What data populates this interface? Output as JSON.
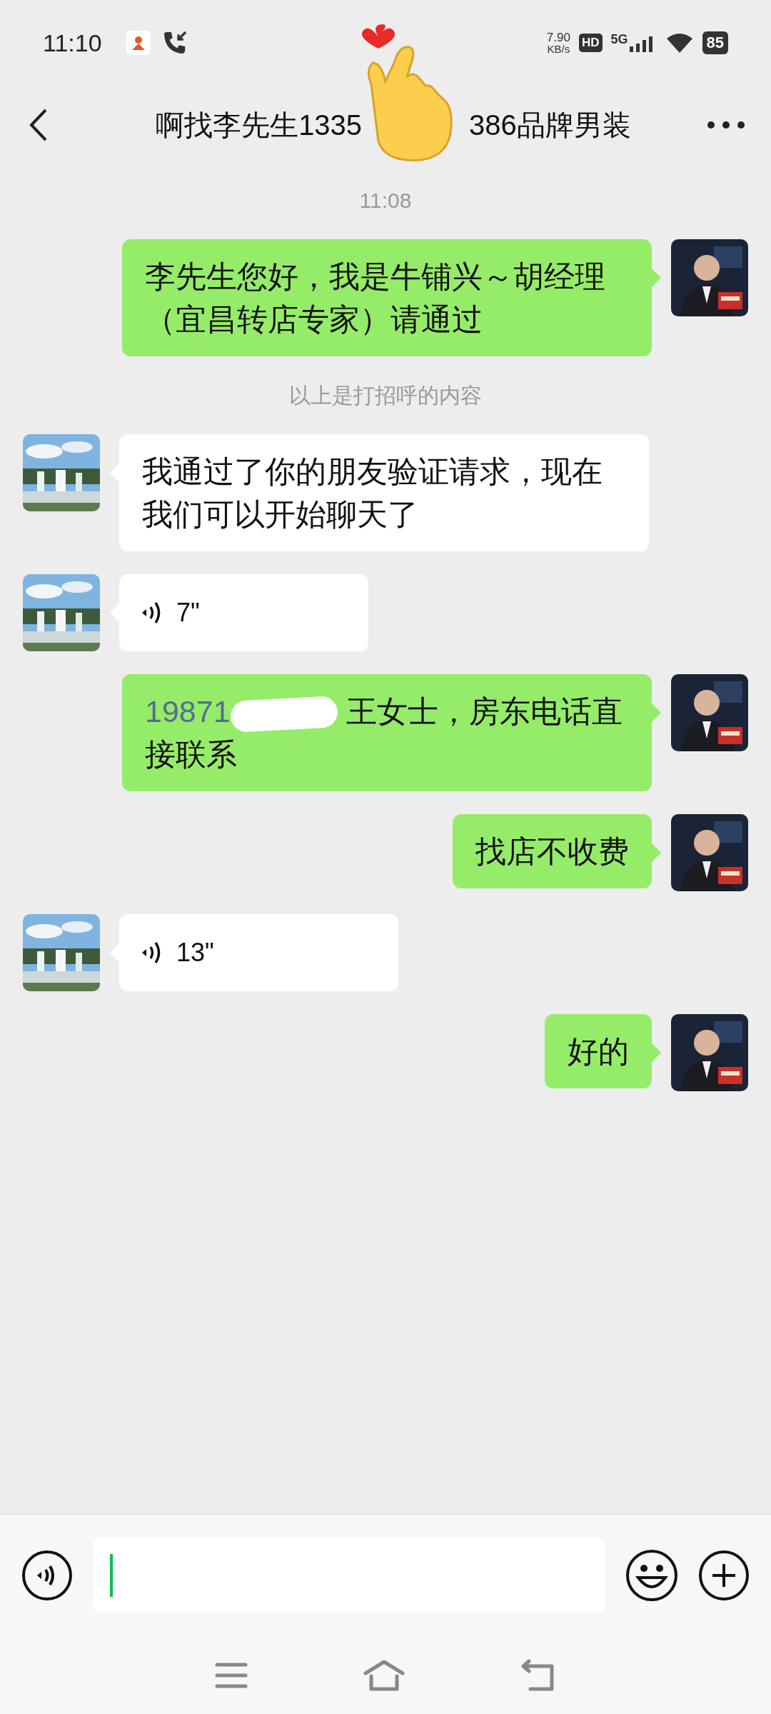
{
  "status_bar": {
    "time": "11:10",
    "speed": "7.90",
    "speed_unit": "KB/s",
    "hd": "HD",
    "network": "5G",
    "battery": "85"
  },
  "header": {
    "title_left": "啊找李先生1335",
    "title_right": "386品牌男装"
  },
  "messages": [
    {
      "kind": "timestamp",
      "text": "11:08"
    },
    {
      "kind": "text",
      "outgoing": true,
      "text": "李先生您好，我是牛铺兴～胡经理（宜昌转店专家）请通过"
    },
    {
      "kind": "system",
      "text": "以上是打招呼的内容"
    },
    {
      "kind": "text",
      "outgoing": false,
      "text": "我通过了你的朋友验证请求，现在我们可以开始聊天了"
    },
    {
      "kind": "voice",
      "outgoing": false,
      "duration": "7\""
    },
    {
      "kind": "text",
      "outgoing": true,
      "link": "19871",
      "redacted": true,
      "text": " 王女士，房东电话直接联系"
    },
    {
      "kind": "text",
      "outgoing": true,
      "text": "找店不收费"
    },
    {
      "kind": "voice",
      "outgoing": false,
      "duration": "13\""
    },
    {
      "kind": "text",
      "outgoing": true,
      "text": "好的"
    }
  ],
  "input": {
    "focused": true
  }
}
